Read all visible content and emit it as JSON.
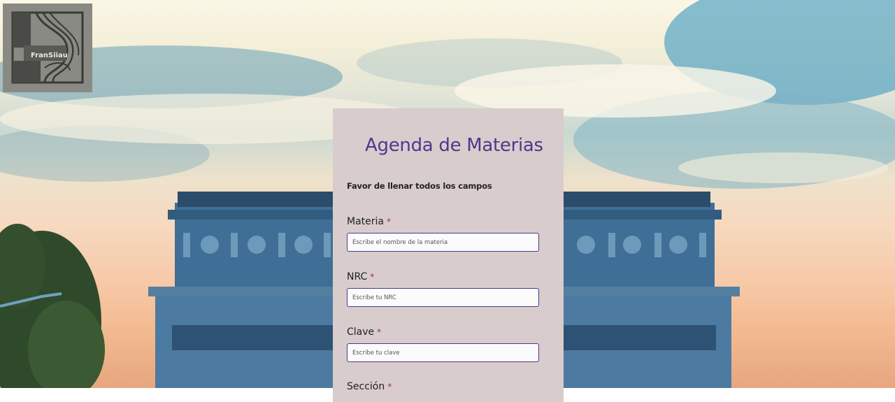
{
  "logo": {
    "text": "FranSiiau"
  },
  "form": {
    "title": "Agenda de Materias",
    "subtitle": "Favor de llenar todos los campos",
    "required_mark": "*",
    "fields": [
      {
        "label": "Materia",
        "placeholder": "Escribe el nombre de la materia"
      },
      {
        "label": "NRC",
        "placeholder": "Escribe tu NRC"
      },
      {
        "label": "Clave",
        "placeholder": "Escribe tu clave"
      },
      {
        "label": "Sección",
        "placeholder": ""
      }
    ]
  },
  "colors": {
    "accent": "#4b3a8c",
    "required": "#9a2c5a",
    "card": "#d9cccd",
    "logo_bg": "#8a8a84"
  }
}
